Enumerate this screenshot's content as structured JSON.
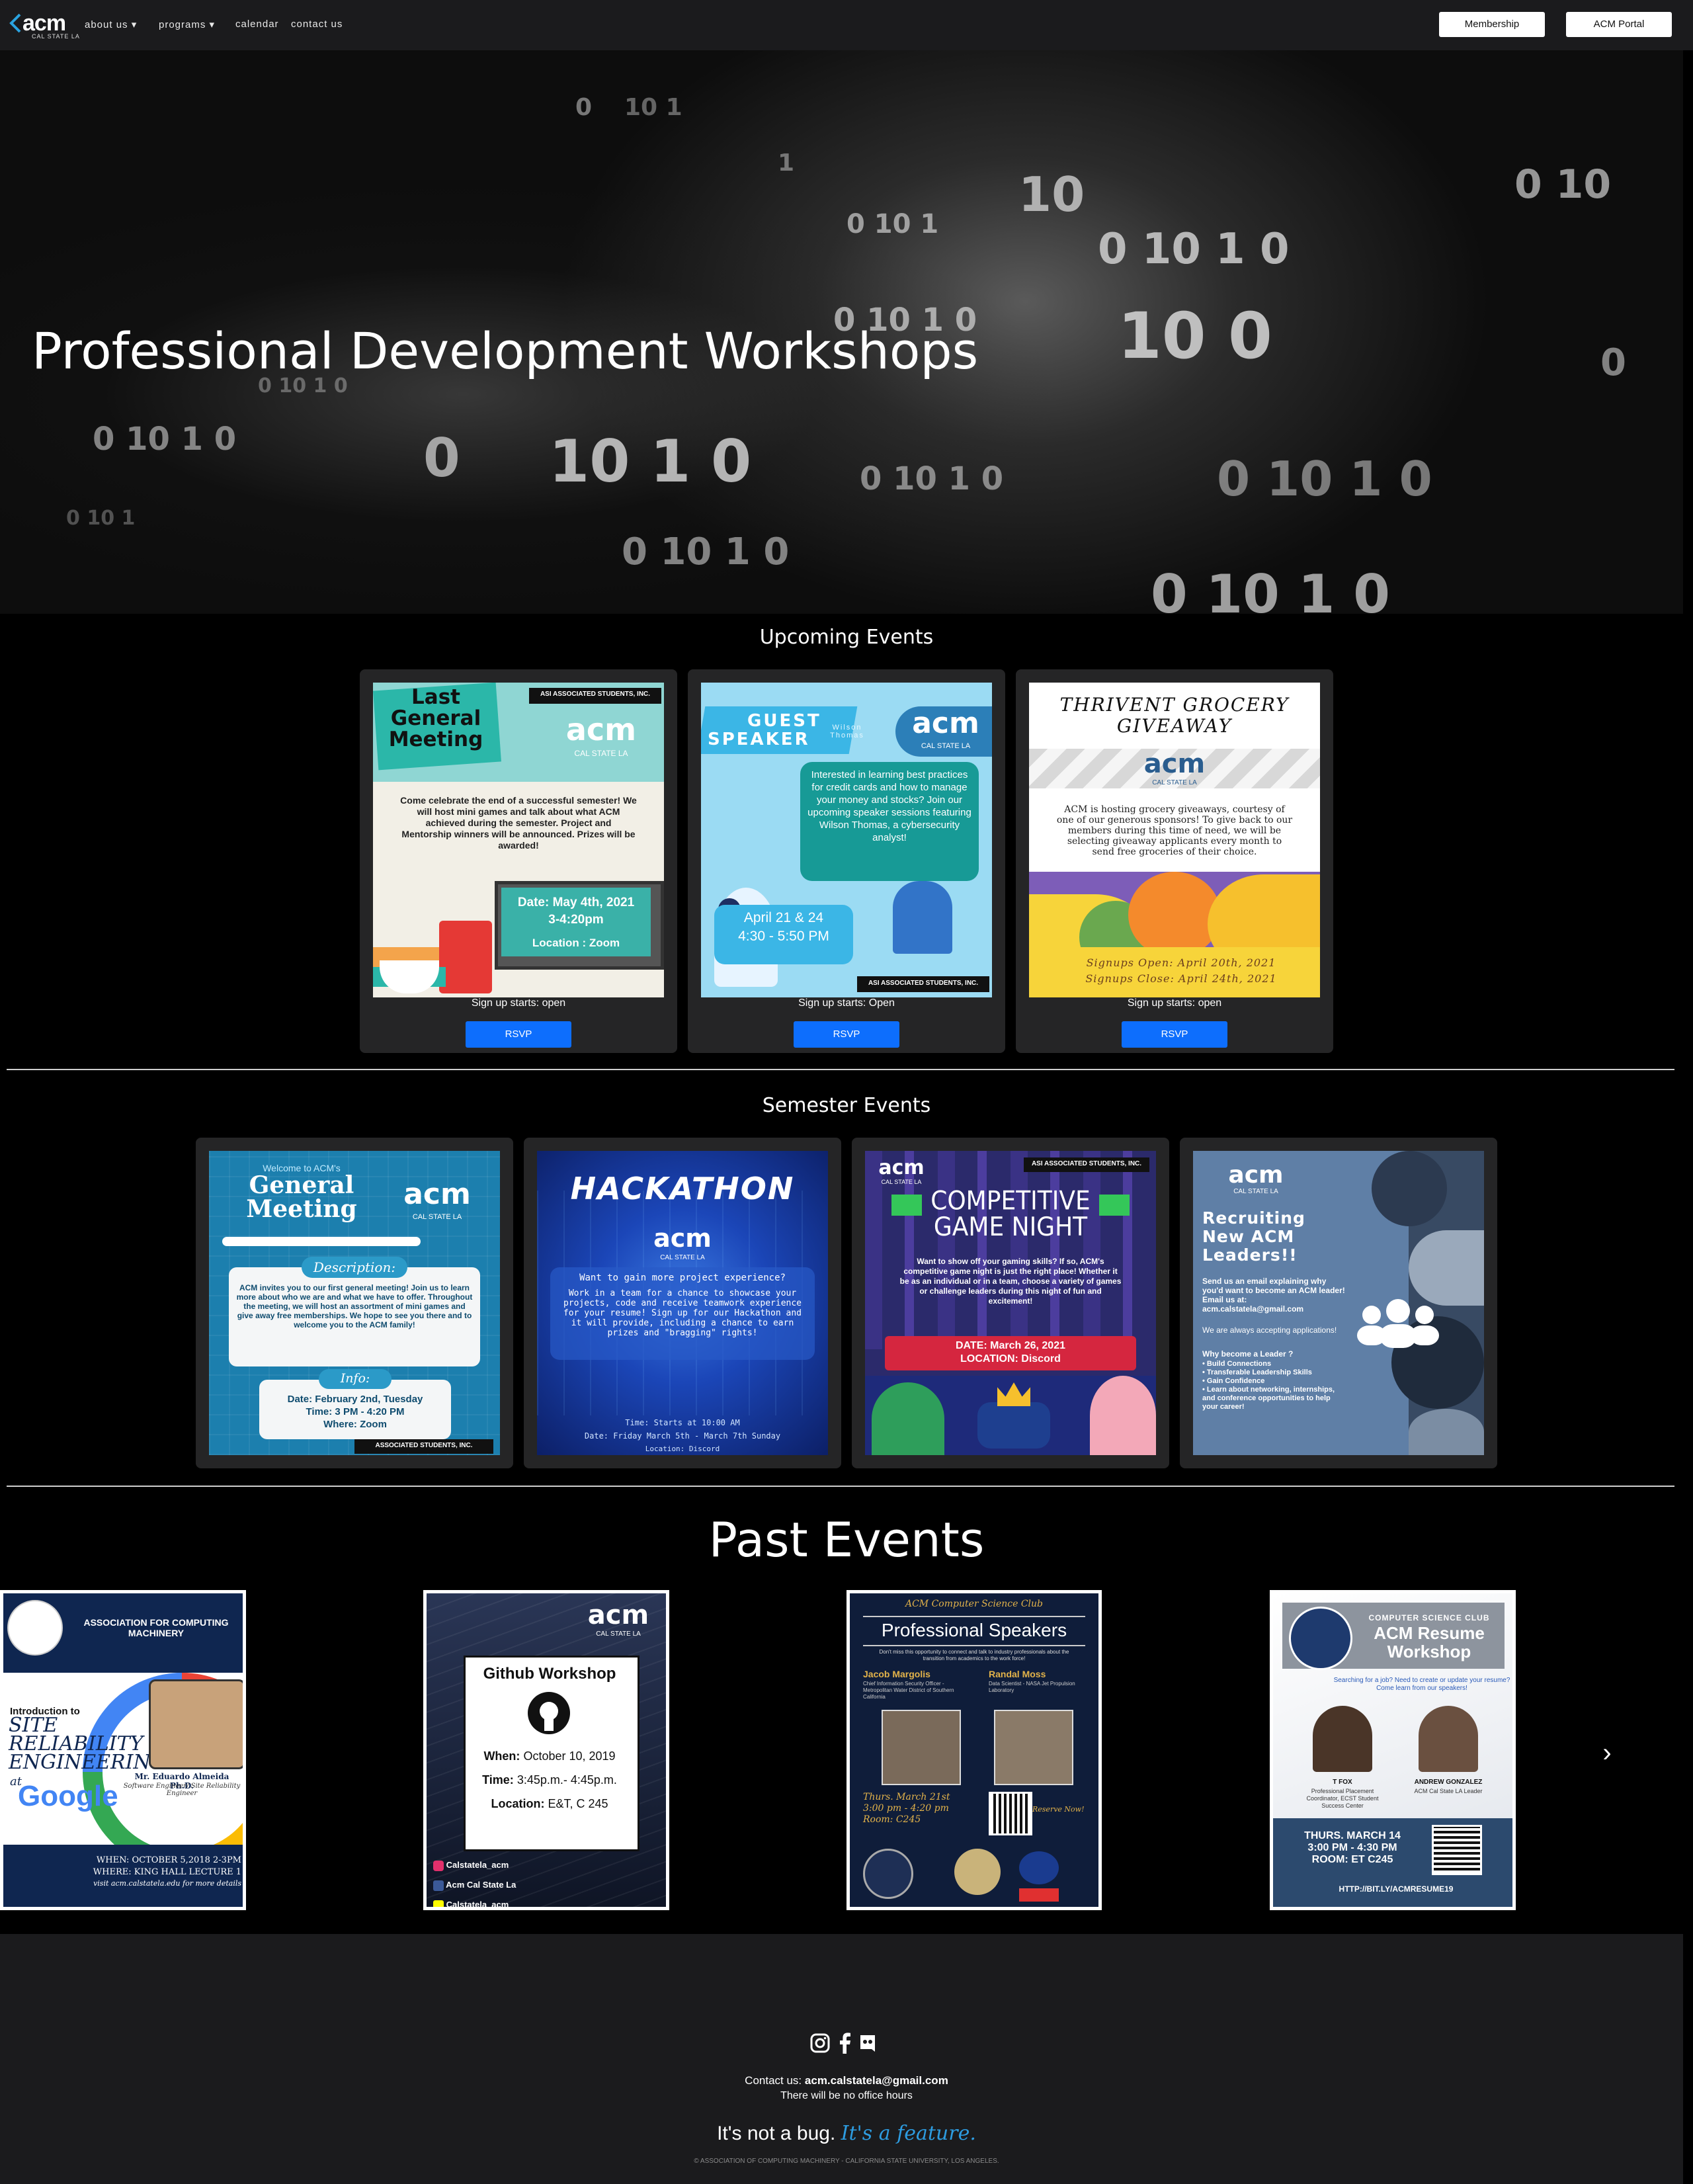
{
  "nav": {
    "logo_text": "acm",
    "logo_sub": "CAL STATE LA",
    "links": [
      "about us",
      "programs",
      "calendar",
      "contact us"
    ],
    "membership_label": "Membership",
    "portal_label": "ACM Portal"
  },
  "hero": {
    "title": "Professional Development Workshops"
  },
  "upcoming": {
    "heading": "Upcoming Events",
    "cards": [
      {
        "signup": "Sign up starts: open",
        "rsvp": "RSVP",
        "poster": {
          "title_lines": [
            "Last",
            "General",
            "Meeting"
          ],
          "logo": "acm",
          "logo_sub": "CAL STATE LA",
          "asi": "ASI ASSOCIATED STUDENTS, INC.",
          "body": "Come celebrate the end of a successful semester! We will host mini games and talk about what ACM achieved during the semester. Project and Mentorship winners will be announced. Prizes will be awarded!",
          "date": "Date: May 4th, 2021",
          "time": "3-4:20pm",
          "location": "Location : Zoom"
        }
      },
      {
        "signup": "Sign up starts: Open",
        "rsvp": "RSVP",
        "poster": {
          "title_lines": [
            "GUEST",
            "SPEAKER"
          ],
          "speaker": "Wilson Thomas",
          "logo": "acm",
          "logo_sub": "CAL STATE LA",
          "body": "Interested in learning best practices for credit cards and how to manage your money and stocks? Join our upcoming speaker sessions featuring Wilson Thomas, a cybersecurity analyst!",
          "dates": "April 21 & 24",
          "time": "4:30 - 5:50 PM",
          "asi": "ASI ASSOCIATED STUDENTS, INC."
        }
      },
      {
        "signup": "Sign up starts: open",
        "rsvp": "RSVP",
        "poster": {
          "title_lines": [
            "THRIVENT GROCERY",
            "GIVEAWAY"
          ],
          "logo": "acm",
          "logo_sub": "CAL STATE LA",
          "body": "ACM is hosting grocery giveaways, courtesy of one of our generous sponsors! To give back to our members during this time of need, we will be selecting giveaway applicants every month to send free groceries of their choice.",
          "open": "Signups Open: April 20th, 2021",
          "close": "Signups Close: April 24th, 2021"
        }
      }
    ]
  },
  "semester": {
    "heading": "Semester Events",
    "cards": [
      {
        "welcome": "Welcome to ACM's",
        "title_lines": [
          "General",
          "Meeting"
        ],
        "logo": "acm",
        "logo_sub": "CAL STATE LA",
        "desc_head": "Description:",
        "desc": "ACM invites you to our first general meeting! Join us to learn more about who we are and what we have to offer. Throughout the meeting, we will host an assortment of mini games and give away free memberships. We hope to see you there and to welcome you to the ACM family!",
        "info_head": "Info:",
        "info_lines": [
          "Date: February 2nd, Tuesday",
          "Time: 3 PM - 4:20 PM",
          "Where: Zoom"
        ],
        "asi": "ASSOCIATED STUDENTS, INC."
      },
      {
        "title": "HACKATHON",
        "logo": "acm",
        "logo_sub": "CAL STATE LA",
        "q": "Want to gain more project experience?",
        "body": "Work in a team for a chance to showcase your projects, code and receive teamwork experience for your resume! Sign up for our Hackathon and it will provide, including a chance to earn prizes and \"bragging\" rights!",
        "time": "Time: Starts at 10:00 AM",
        "date": "Date: Friday March 5th - March 7th Sunday",
        "location": "Location: Discord"
      },
      {
        "logo": "acm",
        "logo_sub": "CAL STATE LA",
        "asi": "ASI ASSOCIATED STUDENTS, INC.",
        "title_lines": [
          "COMPETITIVE",
          "GAME NIGHT"
        ],
        "body": "Want to show off your gaming skills? If so, ACM's competitive game night is just the right place! Whether it be as an individual or in a team, choose a variety of games or challenge leaders during this night of fun and excitement!",
        "date": "DATE: March 26, 2021",
        "location": "LOCATION: Discord"
      },
      {
        "logo": "acm",
        "logo_sub": "CAL STATE LA",
        "title_lines": [
          "Recruiting",
          "New ACM",
          "Leaders!!"
        ],
        "body": "Send us an email explaining why you'd want to become an ACM leader! Email us at: acm.calstatela@gmail.com",
        "accepting": "We are always accepting applications!",
        "why": "Why become a Leader ?",
        "bullets": [
          "Build Connections",
          "Transferable Leadership Skills",
          "Gain Confidence",
          "Learn about networking, internships, and conference opportunities to help your career!"
        ]
      }
    ]
  },
  "past": {
    "heading": "Past Events",
    "items": [
      {
        "org": "ASSOCIATION FOR COMPUTING MACHINERY",
        "intro": "Introduction to",
        "title_lines": [
          "SITE",
          "RELIABILITY",
          "ENGINEERING"
        ],
        "at": "at",
        "google": "Google",
        "speaker": "Mr. Eduardo Almeida Ph.D.",
        "speaker_role": "Software Engineer/ Site Reliability Engineer",
        "when": "WHEN: OCTOBER 5,2018 2-3PM",
        "where": "WHERE: KING HALL LECTURE 1",
        "visit": "visit acm.calstatela.edu for more details"
      },
      {
        "logo": "acm",
        "logo_sub": "CAL STATE LA",
        "title": "Github Workshop",
        "when_label": "When:",
        "when": "October 10, 2019",
        "time_label": "Time:",
        "time": "3:45p.m.- 4:45p.m.",
        "loc_label": "Location:",
        "loc": "E&T, C 245",
        "socials": [
          "Calstatela_acm",
          "Acm Cal State La",
          "Calstatela_acm"
        ]
      },
      {
        "club": "ACM Computer Science Club",
        "title": "Professional Speakers",
        "sub": "Don't miss this opportunity to connect and talk to industry professionals about the transition from academics to the work force!",
        "speaker1": "Jacob Margolis",
        "speaker1_role": "Chief Information Security Officer - Metropolitan Water District of Southern California",
        "speaker2": "Randal Moss",
        "speaker2_role": "Data Scientist - NASA Jet Propulsion Laboratory",
        "date": "Thurs. March 21st",
        "time": "3:00 pm - 4:20 pm",
        "room": "Room: C245",
        "reserve": "Reserve Now!"
      },
      {
        "club": "COMPUTER SCIENCE CLUB",
        "title_lines": [
          "ACM Resume",
          "Workshop"
        ],
        "sub": "Searching for a job? Need to create or update your resume? Come learn from our speakers!",
        "p1": "T FOX",
        "p1_role": "Professional Placement Coordinator, ECST Student Success Center",
        "p2": "ANDREW GONZALEZ",
        "p2_role": "ACM Cal State LA Leader",
        "date": "THURS. MARCH 14",
        "time": "3:00 PM - 4:30 PM",
        "room": "ROOM: ET C245",
        "link": "HTTP://BIT.LY/ACMRESUME19"
      }
    ],
    "next_label": "›"
  },
  "footer": {
    "contact_label": "Contact us:",
    "email": "acm.calstatela@gmail.com",
    "hours": "There will be no office hours",
    "tagline_a": "It's not a bug.",
    "tagline_b": "It's a feature.",
    "copyright": "© ASSOCIATION OF COMPUTING MACHINERY - CALIFORNIA STATE UNIVERSITY, LOS ANGELES."
  },
  "colors": {
    "nav_bg": "#1b1b1d",
    "card_bg": "#252526",
    "rsvp_blue": "#0d6efd",
    "tagline_blue": "#2d9ce0"
  }
}
